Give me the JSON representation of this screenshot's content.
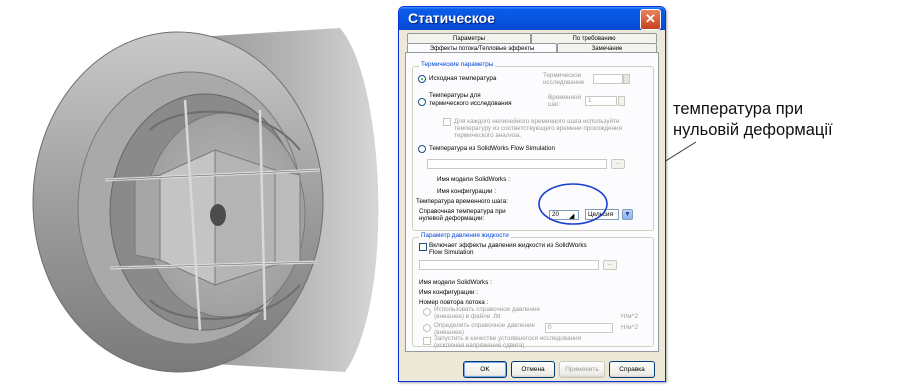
{
  "dialog": {
    "title": "Статическое",
    "tabs_row1": [
      "Параметры",
      "По требованию"
    ],
    "tabs_row2": [
      "Эффекты потока/Тепловые эффекты",
      "Замечание"
    ]
  },
  "thermal": {
    "title": "Термические параметры",
    "initial_temp": "Исходная температура",
    "thermal_study_label": "Термическое исследование",
    "temps_from_thermal_line1": "Температуры для",
    "temps_from_thermal_line2": "термического исследования",
    "time_step_label": "Временной шаг:",
    "time_step_value": "1",
    "per_step_line1": "Для каждого нелинейного временного шага используйте",
    "per_step_line2": "температуру из соответствующего времени прохождения",
    "per_step_line3": "термического анализа.",
    "flow_sim_temp": "Температура из SolidWorks Flow Simulation",
    "model_name": "Имя модели SolidWorks :",
    "config_name": "Имя конфигурации :",
    "time_step_temp": "Температура временного шага:",
    "ref_temp_line1": "Справочная температура при",
    "ref_temp_line2": "нулевой деформации:",
    "ref_temp_value": "20",
    "units_value": "Цельсия"
  },
  "fluid": {
    "title": "Параметр давления жидкости",
    "include_line1": "Включает эффекты давления жидкости из SolidWorks",
    "include_line2": "Flow Simulation",
    "model_name": "Имя модели SolidWorks :",
    "config_name": "Имя конфигурации :",
    "repeat_number": "Номер повтора потока :",
    "use_ref_line1": "Использовать справочное давление",
    "use_ref_line2": "(внешнее) в файле .fld",
    "unit_pa": "Н/м^2",
    "define_ref_line1": "Определить справочное давление",
    "define_ref_line2": "(внешнее)",
    "define_ref_value": "0",
    "steady_line1": "Запустить в качестве устоявшегося исследования",
    "steady_line2": "(исключая напряжение сдвига)"
  },
  "buttons": {
    "ok": "OK",
    "cancel": "Отмена",
    "apply": "Применить",
    "help": "Справка"
  },
  "annotation": {
    "line1": "температура при",
    "line2": "нульовій деформації"
  },
  "colors": {
    "titlebar": "#0554e0",
    "highlight_ellipse": "#1a3fd0",
    "group_title": "#0046d5"
  }
}
